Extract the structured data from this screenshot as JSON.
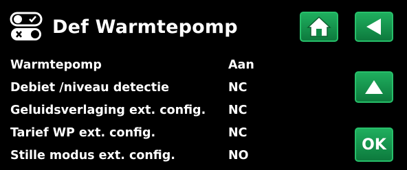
{
  "header": {
    "title": "Def Warmtepomp",
    "icon": "toggle-switches-icon"
  },
  "buttons": {
    "home": {
      "icon": "home-icon"
    },
    "back": {
      "icon": "back-arrow-icon"
    },
    "up": {
      "icon": "up-arrow-icon"
    },
    "ok": {
      "label": "OK"
    }
  },
  "colors": {
    "background": "#000000",
    "button_green": "#0f8a47",
    "text": "#ffffff"
  },
  "rows": [
    {
      "label": "Warmtepomp",
      "value": "Aan"
    },
    {
      "label": "Debiet /niveau detectie",
      "value": "NC"
    },
    {
      "label": "Geluidsverlaging ext. config.",
      "value": "NC"
    },
    {
      "label": "Tarief WP ext. config.",
      "value": "NC"
    },
    {
      "label": "Stille modus ext. config.",
      "value": "NO"
    }
  ]
}
